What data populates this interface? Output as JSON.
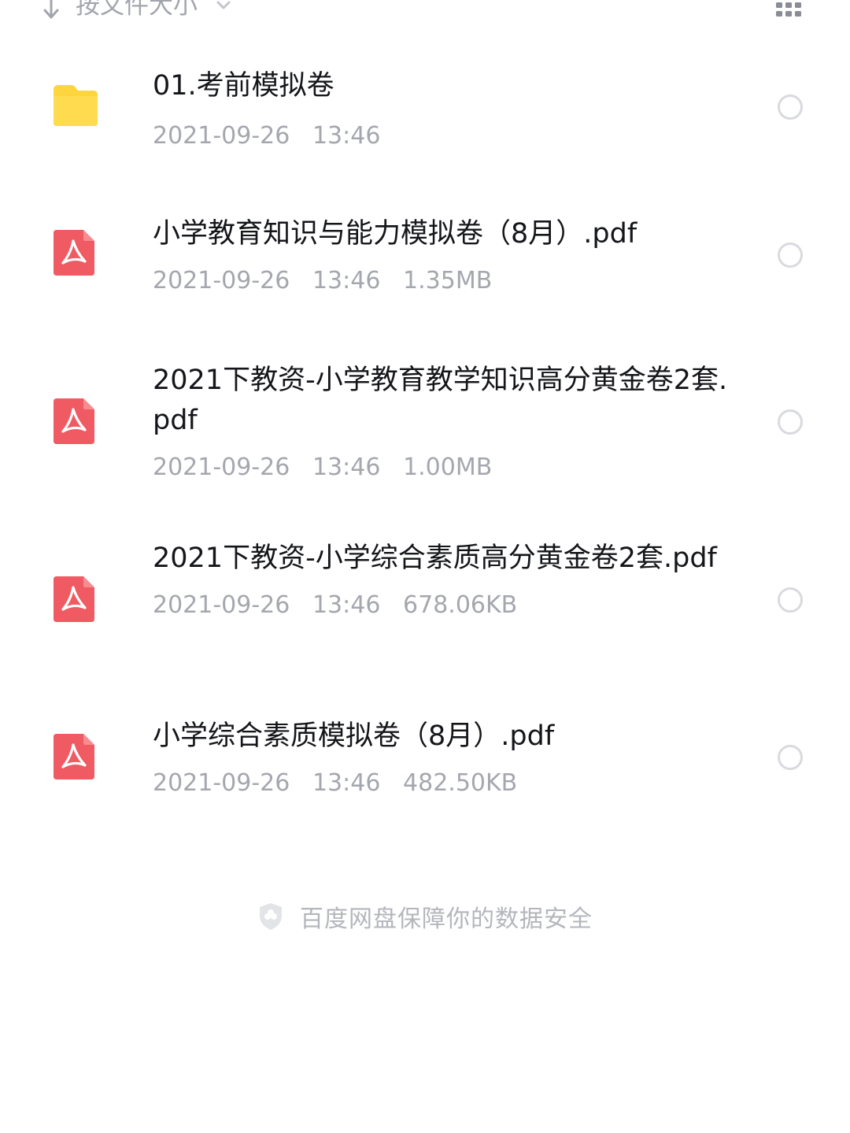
{
  "sort": {
    "label": "按文件大小",
    "arrow_icon": "arrow-down-icon",
    "chevron_icon": "chevron-down-icon"
  },
  "view_toggle_icon": "grid-view-icon",
  "colors": {
    "folder": "#ffd53d",
    "pdf": "#f05a62",
    "meta_text": "#a5a7ae",
    "title_text": "#15161a"
  },
  "files": [
    {
      "type": "folder",
      "icon": "folder-icon",
      "name": "01.考前模拟卷",
      "meta": "2021-09-26   13:46"
    },
    {
      "type": "pdf",
      "icon": "pdf-icon",
      "name": "小学教育知识与能力模拟卷（8月）.pdf",
      "meta": "2021-09-26   13:46   1.35MB"
    },
    {
      "type": "pdf",
      "icon": "pdf-icon",
      "name": "2021下教资-小学教育教学知识高分黄金卷2套.pdf",
      "meta": "2021-09-26   13:46   1.00MB"
    },
    {
      "type": "pdf",
      "icon": "pdf-icon",
      "name": "2021下教资-小学综合素质高分黄金卷2套.pdf",
      "meta": "2021-09-26   13:46   678.06KB"
    },
    {
      "type": "pdf",
      "icon": "pdf-icon",
      "name": "小学综合素质模拟卷（8月）.pdf",
      "meta": "2021-09-26   13:46   482.50KB"
    }
  ],
  "footer": {
    "icon": "shield-icon",
    "text": "百度网盘保障你的数据安全"
  }
}
